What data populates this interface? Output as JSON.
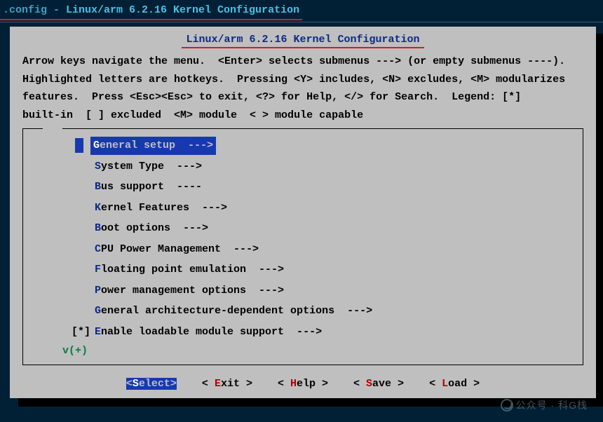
{
  "titlebar": {
    "left": ".config - ",
    "right": "Linux/arm 6.2.16 Kernel Configuration"
  },
  "panel": {
    "title": "Linux/arm 6.2.16 Kernel Configuration",
    "help": "Arrow keys navigate the menu.  <Enter> selects submenus ---> (or empty submenus ----).\nHighlighted letters are hotkeys.  Pressing <Y> includes, <N> excludes, <M> modularizes\nfeatures.  Press <Esc><Esc> to exit, <?> for Help, </> for Search.  Legend: [*]\nbuilt-in  [ ] excluded  <M> module  < > module capable"
  },
  "menu": {
    "items": [
      {
        "mark": "",
        "hot": "G",
        "rest": "eneral setup  --->",
        "selected": true
      },
      {
        "mark": "",
        "hot": "S",
        "rest": "ystem Type  --->",
        "selected": false
      },
      {
        "mark": "",
        "hot": "B",
        "rest": "us support  ----",
        "selected": false
      },
      {
        "mark": "",
        "hot": "K",
        "rest": "ernel Features  --->",
        "selected": false
      },
      {
        "mark": "",
        "hot": "B",
        "rest": "oot options  --->",
        "selected": false
      },
      {
        "mark": "",
        "hot": "C",
        "rest": "PU Power Management  --->",
        "selected": false
      },
      {
        "mark": "",
        "hot": "F",
        "rest": "loating point emulation  --->",
        "selected": false
      },
      {
        "mark": "",
        "hot": "P",
        "rest": "ower management options  --->",
        "selected": false
      },
      {
        "mark": "",
        "hot": "G",
        "rest": "eneral architecture-dependent options  --->",
        "selected": false
      },
      {
        "mark": "[*]",
        "hot": "E",
        "rest": "nable loadable module support  --->",
        "selected": false
      }
    ],
    "more": "v(+)"
  },
  "buttons": [
    {
      "pre": "<",
      "hot": "S",
      "rest": "elect>",
      "selected": true
    },
    {
      "pre": "< ",
      "hot": "E",
      "rest": "xit >",
      "selected": false
    },
    {
      "pre": "< ",
      "hot": "H",
      "rest": "elp >",
      "selected": false
    },
    {
      "pre": "< ",
      "hot": "S",
      "rest": "ave >",
      "selected": false
    },
    {
      "pre": "< ",
      "hot": "L",
      "rest": "oad >",
      "selected": false
    }
  ],
  "watermark": "公众号 · 科G栈"
}
